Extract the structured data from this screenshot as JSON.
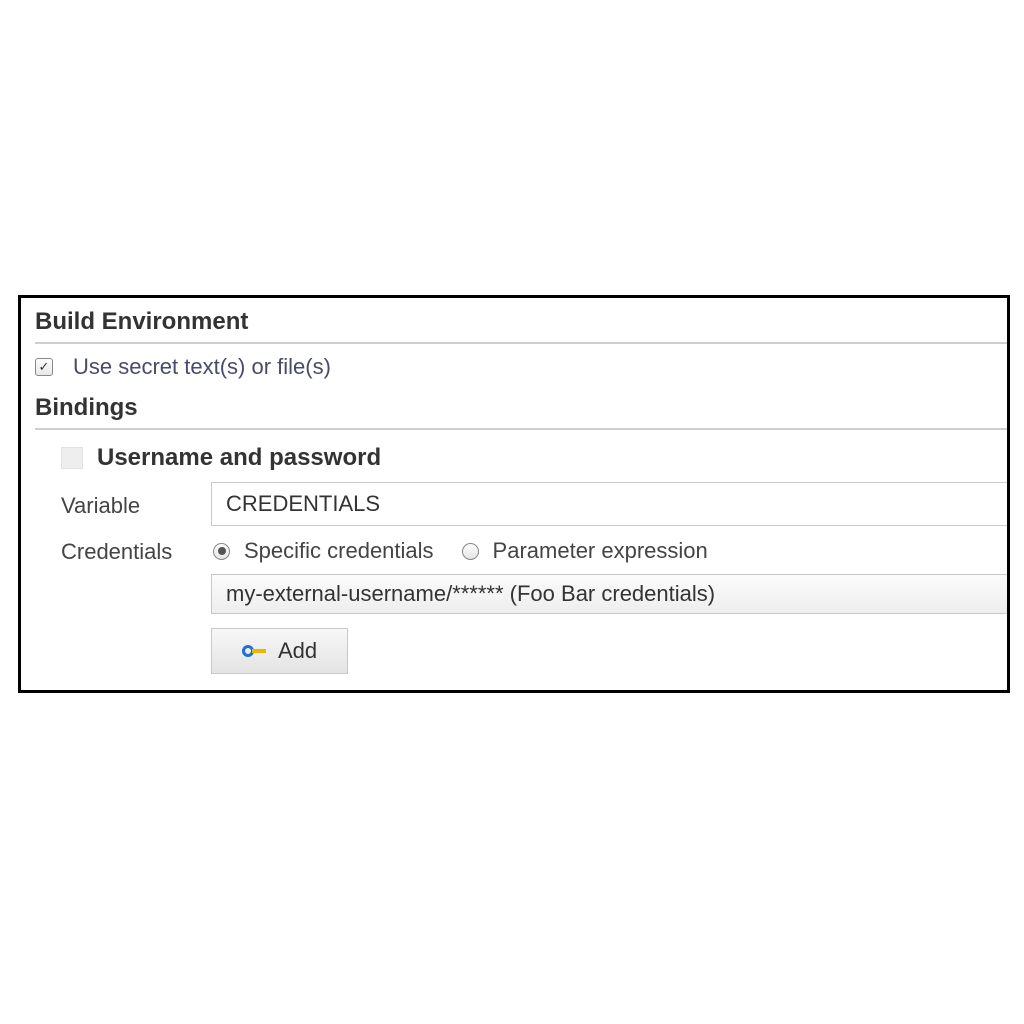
{
  "sections": {
    "build_env_title": "Build Environment",
    "bindings_title": "Bindings"
  },
  "build_env": {
    "use_secret_label": "Use secret text(s) or file(s)",
    "use_secret_checked": true
  },
  "binding": {
    "title": "Username and password",
    "variable_label": "Variable",
    "variable_value": "CREDENTIALS",
    "credentials_label": "Credentials",
    "radio_specific": "Specific credentials",
    "radio_param": "Parameter expression",
    "selected_credential": "my-external-username/****** (Foo Bar credentials)",
    "add_label": "Add"
  }
}
